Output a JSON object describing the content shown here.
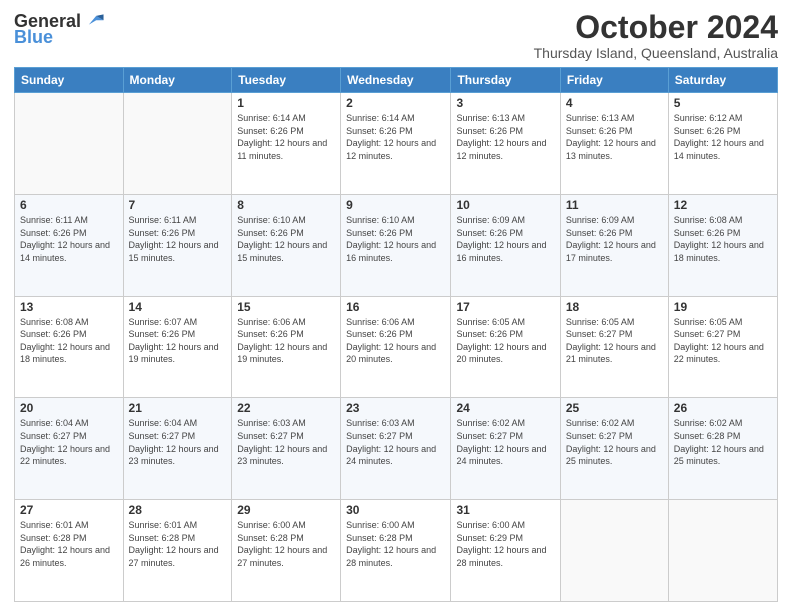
{
  "header": {
    "logo": {
      "text_general": "General",
      "text_blue": "Blue"
    },
    "title": "October 2024",
    "subtitle": "Thursday Island, Queensland, Australia"
  },
  "days_of_week": [
    "Sunday",
    "Monday",
    "Tuesday",
    "Wednesday",
    "Thursday",
    "Friday",
    "Saturday"
  ],
  "weeks": [
    [
      {
        "day": "",
        "info": ""
      },
      {
        "day": "",
        "info": ""
      },
      {
        "day": "1",
        "info": "Sunrise: 6:14 AM\nSunset: 6:26 PM\nDaylight: 12 hours and 11 minutes."
      },
      {
        "day": "2",
        "info": "Sunrise: 6:14 AM\nSunset: 6:26 PM\nDaylight: 12 hours and 12 minutes."
      },
      {
        "day": "3",
        "info": "Sunrise: 6:13 AM\nSunset: 6:26 PM\nDaylight: 12 hours and 12 minutes."
      },
      {
        "day": "4",
        "info": "Sunrise: 6:13 AM\nSunset: 6:26 PM\nDaylight: 12 hours and 13 minutes."
      },
      {
        "day": "5",
        "info": "Sunrise: 6:12 AM\nSunset: 6:26 PM\nDaylight: 12 hours and 14 minutes."
      }
    ],
    [
      {
        "day": "6",
        "info": "Sunrise: 6:11 AM\nSunset: 6:26 PM\nDaylight: 12 hours and 14 minutes."
      },
      {
        "day": "7",
        "info": "Sunrise: 6:11 AM\nSunset: 6:26 PM\nDaylight: 12 hours and 15 minutes."
      },
      {
        "day": "8",
        "info": "Sunrise: 6:10 AM\nSunset: 6:26 PM\nDaylight: 12 hours and 15 minutes."
      },
      {
        "day": "9",
        "info": "Sunrise: 6:10 AM\nSunset: 6:26 PM\nDaylight: 12 hours and 16 minutes."
      },
      {
        "day": "10",
        "info": "Sunrise: 6:09 AM\nSunset: 6:26 PM\nDaylight: 12 hours and 16 minutes."
      },
      {
        "day": "11",
        "info": "Sunrise: 6:09 AM\nSunset: 6:26 PM\nDaylight: 12 hours and 17 minutes."
      },
      {
        "day": "12",
        "info": "Sunrise: 6:08 AM\nSunset: 6:26 PM\nDaylight: 12 hours and 18 minutes."
      }
    ],
    [
      {
        "day": "13",
        "info": "Sunrise: 6:08 AM\nSunset: 6:26 PM\nDaylight: 12 hours and 18 minutes."
      },
      {
        "day": "14",
        "info": "Sunrise: 6:07 AM\nSunset: 6:26 PM\nDaylight: 12 hours and 19 minutes."
      },
      {
        "day": "15",
        "info": "Sunrise: 6:06 AM\nSunset: 6:26 PM\nDaylight: 12 hours and 19 minutes."
      },
      {
        "day": "16",
        "info": "Sunrise: 6:06 AM\nSunset: 6:26 PM\nDaylight: 12 hours and 20 minutes."
      },
      {
        "day": "17",
        "info": "Sunrise: 6:05 AM\nSunset: 6:26 PM\nDaylight: 12 hours and 20 minutes."
      },
      {
        "day": "18",
        "info": "Sunrise: 6:05 AM\nSunset: 6:27 PM\nDaylight: 12 hours and 21 minutes."
      },
      {
        "day": "19",
        "info": "Sunrise: 6:05 AM\nSunset: 6:27 PM\nDaylight: 12 hours and 22 minutes."
      }
    ],
    [
      {
        "day": "20",
        "info": "Sunrise: 6:04 AM\nSunset: 6:27 PM\nDaylight: 12 hours and 22 minutes."
      },
      {
        "day": "21",
        "info": "Sunrise: 6:04 AM\nSunset: 6:27 PM\nDaylight: 12 hours and 23 minutes."
      },
      {
        "day": "22",
        "info": "Sunrise: 6:03 AM\nSunset: 6:27 PM\nDaylight: 12 hours and 23 minutes."
      },
      {
        "day": "23",
        "info": "Sunrise: 6:03 AM\nSunset: 6:27 PM\nDaylight: 12 hours and 24 minutes."
      },
      {
        "day": "24",
        "info": "Sunrise: 6:02 AM\nSunset: 6:27 PM\nDaylight: 12 hours and 24 minutes."
      },
      {
        "day": "25",
        "info": "Sunrise: 6:02 AM\nSunset: 6:27 PM\nDaylight: 12 hours and 25 minutes."
      },
      {
        "day": "26",
        "info": "Sunrise: 6:02 AM\nSunset: 6:28 PM\nDaylight: 12 hours and 25 minutes."
      }
    ],
    [
      {
        "day": "27",
        "info": "Sunrise: 6:01 AM\nSunset: 6:28 PM\nDaylight: 12 hours and 26 minutes."
      },
      {
        "day": "28",
        "info": "Sunrise: 6:01 AM\nSunset: 6:28 PM\nDaylight: 12 hours and 27 minutes."
      },
      {
        "day": "29",
        "info": "Sunrise: 6:00 AM\nSunset: 6:28 PM\nDaylight: 12 hours and 27 minutes."
      },
      {
        "day": "30",
        "info": "Sunrise: 6:00 AM\nSunset: 6:28 PM\nDaylight: 12 hours and 28 minutes."
      },
      {
        "day": "31",
        "info": "Sunrise: 6:00 AM\nSunset: 6:29 PM\nDaylight: 12 hours and 28 minutes."
      },
      {
        "day": "",
        "info": ""
      },
      {
        "day": "",
        "info": ""
      }
    ]
  ]
}
